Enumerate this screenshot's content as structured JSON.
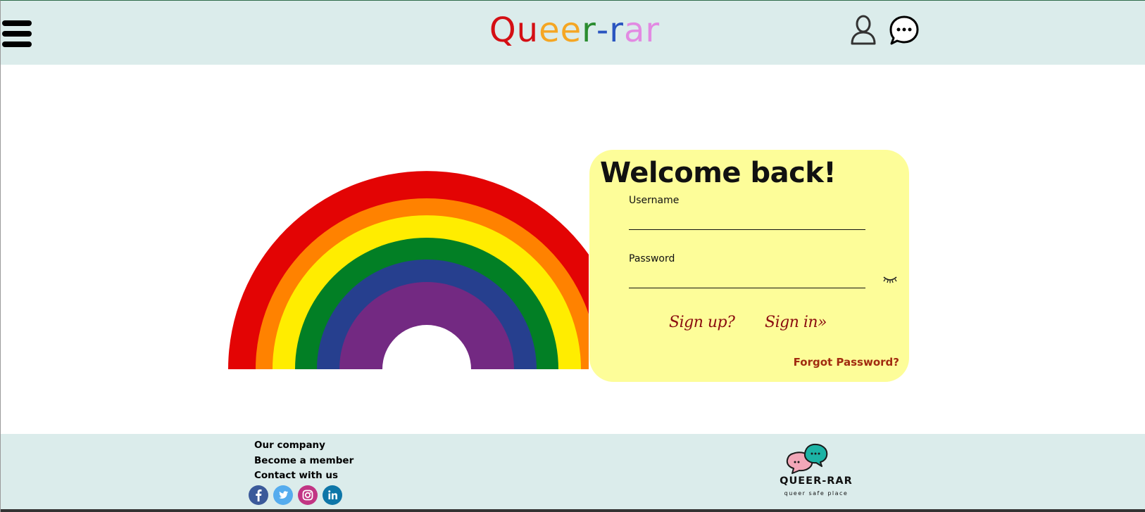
{
  "header": {
    "logo_letters": [
      {
        "char": "Q",
        "color": "#d40f14"
      },
      {
        "char": "u",
        "color": "#d40f14"
      },
      {
        "char": "e",
        "color": "#f5a623"
      },
      {
        "char": "e",
        "color": "#f5a623"
      },
      {
        "char": "r",
        "color": "#2a8c2f"
      },
      {
        "char": "-",
        "color": "#2a55c0"
      },
      {
        "char": "r",
        "color": "#2a55c0"
      },
      {
        "char": "a",
        "color": "#e28ae2"
      },
      {
        "char": "r",
        "color": "#e28ae2"
      }
    ],
    "icons": [
      "hamburger-menu-icon",
      "user-icon",
      "chat-bubble-icon"
    ]
  },
  "rainbow_colors": [
    "#e30404",
    "#ff8200",
    "#ffed00",
    "#027f25",
    "#263f8e",
    "#732982"
  ],
  "login": {
    "title": "Welcome back!",
    "username_label": "Username",
    "username_value": "",
    "password_label": "Password",
    "password_value": "",
    "signup_label": "Sign up?",
    "signin_label": "Sign in»",
    "forgot_label": "Forgot Password?",
    "eye_icon": "eye-closed-icon"
  },
  "footer": {
    "links": [
      "Our company",
      "Become a member",
      "Contact with us"
    ],
    "social": [
      {
        "name": "facebook-icon",
        "color": "#3b5a9a"
      },
      {
        "name": "twitter-icon",
        "color": "#55acee"
      },
      {
        "name": "instagram-icon",
        "color": "#c13584"
      },
      {
        "name": "linkedin-icon",
        "color": "#0e76a8"
      }
    ],
    "brand_name": "QUEER-RAR",
    "brand_tagline": "queer safe place"
  },
  "colors": {
    "header_bg": "#dbeceb",
    "card_bg": "#fdfd99",
    "link_red": "#8b0d10"
  }
}
